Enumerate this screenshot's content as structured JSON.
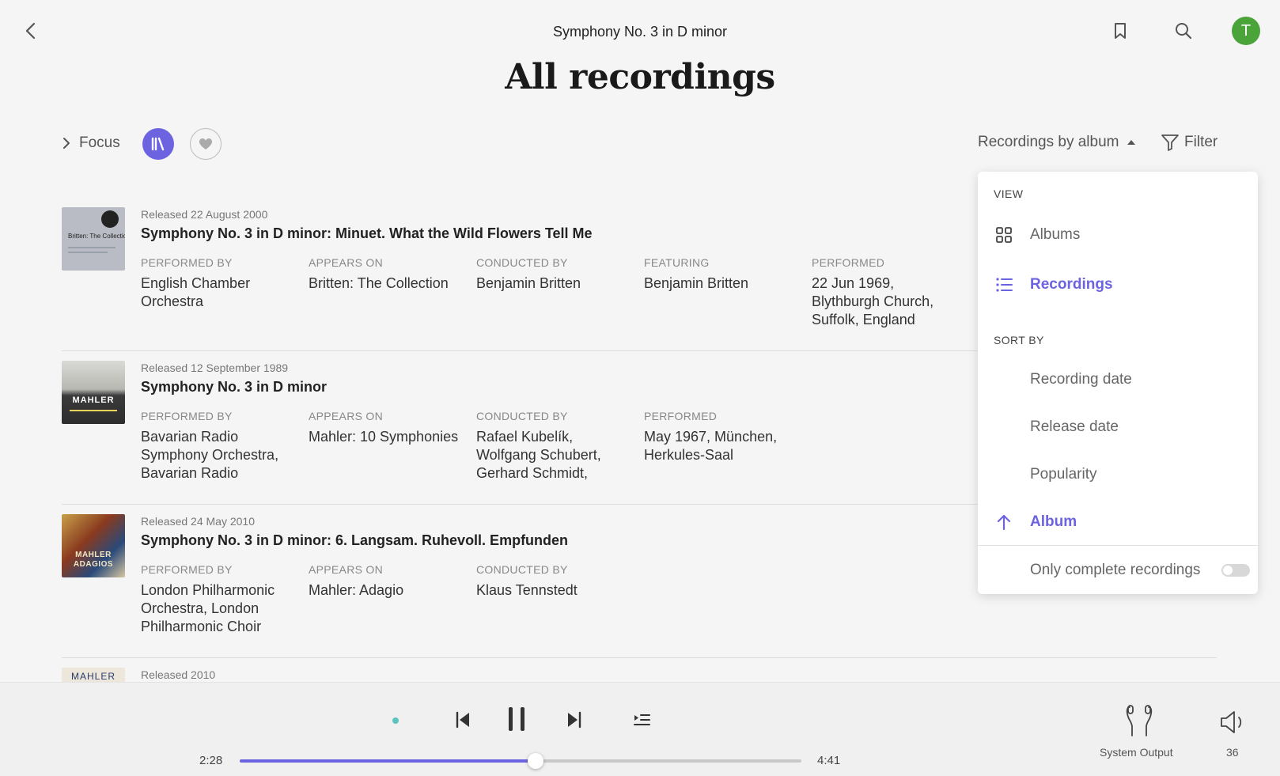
{
  "header": {
    "work_title": "Symphony No. 3 in D minor",
    "avatar_letter": "T"
  },
  "page_title": "All recordings",
  "toolbar": {
    "focus_label": "Focus",
    "sort_label": "Recordings by album",
    "filter_label": "Filter"
  },
  "recordings": [
    {
      "released": "Released 22 August 2000",
      "title": "Symphony No. 3 in D minor: Minuet. What the Wild Flowers Tell Me",
      "cover_text": "Britten: The Collection",
      "columns": [
        {
          "header": "PERFORMED BY",
          "value": "English Chamber Orchestra"
        },
        {
          "header": "APPEARS ON",
          "value": "Britten: The Collection"
        },
        {
          "header": "CONDUCTED BY",
          "value": "Benjamin Britten"
        },
        {
          "header": "FEATURING",
          "value": "Benjamin Britten"
        },
        {
          "header": "PERFORMED",
          "value": "22 Jun 1969, Blythburgh Church, Suffolk, England"
        }
      ]
    },
    {
      "released": "Released 12 September 1989",
      "title": "Symphony No. 3 in D minor",
      "cover_text": "MAHLER",
      "columns": [
        {
          "header": "PERFORMED BY",
          "value": "Bavarian Radio Symphony Orchestra, Bavarian Radio"
        },
        {
          "header": "APPEARS ON",
          "value": "Mahler: 10 Symphonies"
        },
        {
          "header": "CONDUCTED BY",
          "value": "Rafael Kubelík, Wolfgang Schubert, Gerhard Schmidt,"
        },
        {
          "header": "PERFORMED",
          "value": "May 1967, München, Herkules-Saal"
        }
      ]
    },
    {
      "released": "Released 24 May 2010",
      "title": "Symphony No. 3 in D minor: 6. Langsam. Ruhevoll. Empfunden",
      "cover_text": "MAHLER ADAGIOS",
      "columns": [
        {
          "header": "PERFORMED BY",
          "value": "London Philharmonic Orchestra, London Philharmonic Choir"
        },
        {
          "header": "APPEARS ON",
          "value": "Mahler: Adagio"
        },
        {
          "header": "CONDUCTED BY",
          "value": "Klaus Tennstedt"
        }
      ]
    },
    {
      "released": "Released 2010",
      "cover_text": "MAHLER"
    }
  ],
  "dropdown": {
    "view_heading": "VIEW",
    "view_items": [
      {
        "label": "Albums",
        "icon": "grid-icon",
        "active": false
      },
      {
        "label": "Recordings",
        "icon": "list-icon",
        "active": true
      }
    ],
    "sort_heading": "SORT BY",
    "sort_items": [
      {
        "label": "Recording date",
        "active": false
      },
      {
        "label": "Release date",
        "active": false
      },
      {
        "label": "Popularity",
        "active": false
      },
      {
        "label": "Album",
        "icon": "arrow-up-icon",
        "active": true
      }
    ],
    "complete_label": "Only complete recordings",
    "complete_enabled": false
  },
  "player": {
    "elapsed": "2:28",
    "total": "4:41",
    "progress": 0.5267,
    "output_label": "System Output",
    "volume": "36"
  },
  "colors": {
    "accent": "#6c63e0",
    "avatar": "#4aa43a",
    "status_dot": "#5bc4c0"
  }
}
